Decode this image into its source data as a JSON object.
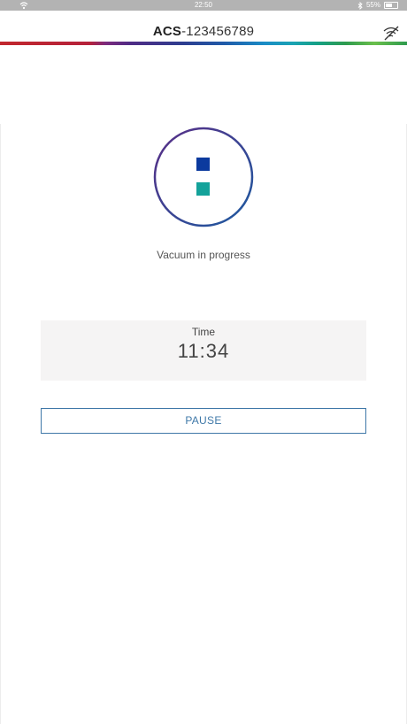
{
  "status_bar": {
    "time": "22:50",
    "battery_percent_label": "55%",
    "battery_level": 0.55,
    "icons": [
      "wifi-icon",
      "bluetooth-icon",
      "battery-icon"
    ]
  },
  "header": {
    "title_prefix": "ACS",
    "title_suffix": "-123456789",
    "connection_icon": "wifi-off-icon"
  },
  "process": {
    "status_text": "Vacuum in progress",
    "indicator_colors": {
      "ring_start": "#5a2d86",
      "ring_end": "#1c5aa0",
      "top_square": "#0b3a9e",
      "bottom_square": "#14a29a"
    }
  },
  "timer": {
    "label": "Time",
    "value": "11:34"
  },
  "actions": {
    "pause_label": "PAUSE"
  },
  "colors": {
    "accent": "#3f78a8",
    "panel_bg": "#f5f4f4",
    "status_bar_bg": "#b3b3b3"
  }
}
